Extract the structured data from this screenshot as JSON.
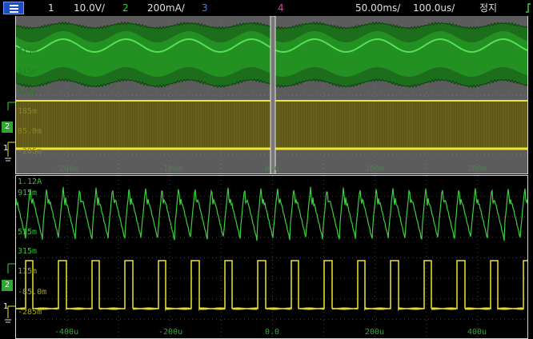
{
  "top_bar": {
    "ch1": {
      "num": "1",
      "scale": "10.0V/",
      "color": "#e0e0e0"
    },
    "ch2": {
      "num": "2",
      "scale": "200mA/",
      "color": "#35d335"
    },
    "ch3": {
      "num": "3",
      "color": "#3b82f6"
    },
    "ch4": {
      "num": "4",
      "color": "#e83ab6"
    },
    "timebase": "50.00ms/",
    "zoom_timebase": "100.0us/",
    "run_state": "정지",
    "trigger_icon": "trigger-edge-icon"
  },
  "colors": {
    "ch1": "#f0e52a",
    "ch2": "#3ccf3c",
    "grid": "#3c3c3c",
    "axis_text": "#2faa2f"
  },
  "zoom_panel": {
    "ch2_labels": [
      "715m",
      "515m",
      "315m"
    ],
    "ch1_labels": [
      "185m",
      "85.0m",
      "-285m"
    ],
    "time_labels": [
      "-200m",
      "-100m",
      "0.0",
      "100m",
      "200m"
    ]
  },
  "main_panel": {
    "ch2_labels": [
      "1.12A",
      "915m",
      "515m",
      "315m"
    ],
    "ch1_labels": [
      "115m",
      "-85.0m",
      "-285m"
    ],
    "time_labels": [
      "-400u",
      "-200u",
      "0.0",
      "200u",
      "400u"
    ]
  },
  "ground_markers": {
    "ch2": "2",
    "ch1": "1",
    "ch2_icon": "ground-marker-ch2-icon",
    "ch1_icon": "ground-marker-ch1-icon"
  }
}
